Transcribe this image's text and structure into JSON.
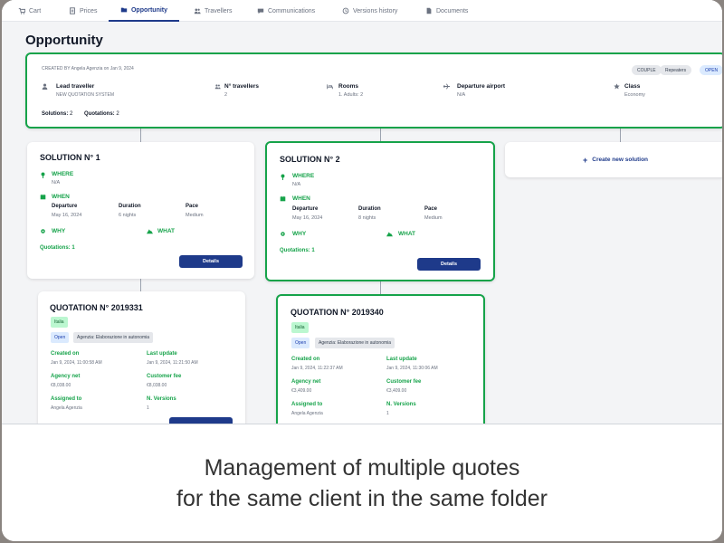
{
  "tabs": [
    {
      "label": "Cart",
      "icon": "cart-icon"
    },
    {
      "label": "Prices",
      "icon": "receipt-icon"
    },
    {
      "label": "Opportunity",
      "icon": "folder-icon"
    },
    {
      "label": "Travellers",
      "icon": "users-icon"
    },
    {
      "label": "Communications",
      "icon": "chat-icon"
    },
    {
      "label": "Versions history",
      "icon": "history-icon"
    },
    {
      "label": "Documents",
      "icon": "document-icon"
    }
  ],
  "title": "Opportunity",
  "summary": {
    "created_by": "CREATED BY Angela Agenzia on Jan 9, 2024",
    "badges": [
      "COUPLE",
      "Repeaters",
      "OPEN"
    ],
    "fields": [
      {
        "label": "Lead traveller",
        "value": "NEW QUOTATION SYSTEM",
        "icon": "person-icon"
      },
      {
        "label": "N° travellers",
        "value": "2",
        "icon": "users-icon"
      },
      {
        "label": "Rooms",
        "value": "1. Adults: 2",
        "icon": "bed-icon"
      },
      {
        "label": "Departure airport",
        "value": "N/A",
        "icon": "plane-icon"
      },
      {
        "label": "Class",
        "value": "Economy",
        "icon": "star-icon"
      }
    ],
    "solutions_label": "Solutions:",
    "solutions_count": "2",
    "quotations_label": "Quotations:",
    "quotations_count": "2"
  },
  "solutions": [
    {
      "title": "SOLUTION N° 1",
      "where_label": "WHERE",
      "where": "N/A",
      "when_label": "WHEN",
      "departure_label": "Departure",
      "departure": "May 16, 2024",
      "duration_label": "Duration",
      "duration": "6 nights",
      "pace_label": "Pace",
      "pace": "Medium",
      "why_label": "WHY",
      "what_label": "WHAT",
      "quotations": "Quotations: 1",
      "details": "Details"
    },
    {
      "title": "SOLUTION N° 2",
      "where_label": "WHERE",
      "where": "N/A",
      "when_label": "WHEN",
      "departure_label": "Departure",
      "departure": "May 16, 2024",
      "duration_label": "Duration",
      "duration": "8 nights",
      "pace_label": "Pace",
      "pace": "Medium",
      "why_label": "WHY",
      "what_label": "WHAT",
      "quotations": "Quotations: 1",
      "details": "Details"
    }
  ],
  "create_solution": "Create new solution",
  "quotations": [
    {
      "title": "QUOTATION N° 2019331",
      "country": "Italia",
      "status": "Open",
      "agency": "Agenzia: Elaborazione in autonomia",
      "created_label": "Created on",
      "created": "Jan 9, 2024, 11:00:58 AM",
      "update_label": "Last update",
      "update": "Jan 9, 2024, 11:21:50 AM",
      "net_label": "Agency net",
      "net": "€8,038.00",
      "fee_label": "Customer fee",
      "fee": "€8,038.00",
      "assigned_label": "Assigned to",
      "assigned": "Angela Agenzia",
      "versions_label": "N. Versions",
      "versions": "1"
    },
    {
      "title": "QUOTATION N° 2019340",
      "country": "Italia",
      "status": "Open",
      "agency": "Agenzia: Elaborazione in autonomia",
      "created_label": "Created on",
      "created": "Jan 9, 2024, 11:22:37 AM",
      "update_label": "Last update",
      "update": "Jan 9, 2024, 11:30:06 AM",
      "net_label": "Agency net",
      "net": "€3,409.00",
      "fee_label": "Customer fee",
      "fee": "€3,409.00",
      "assigned_label": "Assigned to",
      "assigned": "Angela Agenzia",
      "versions_label": "N. Versions",
      "versions": "1"
    }
  ],
  "caption": [
    "Management of multiple quotes",
    "for the same client in the same folder"
  ],
  "colors": {
    "accent": "#1e3a8a",
    "selected": "#16a34a"
  }
}
